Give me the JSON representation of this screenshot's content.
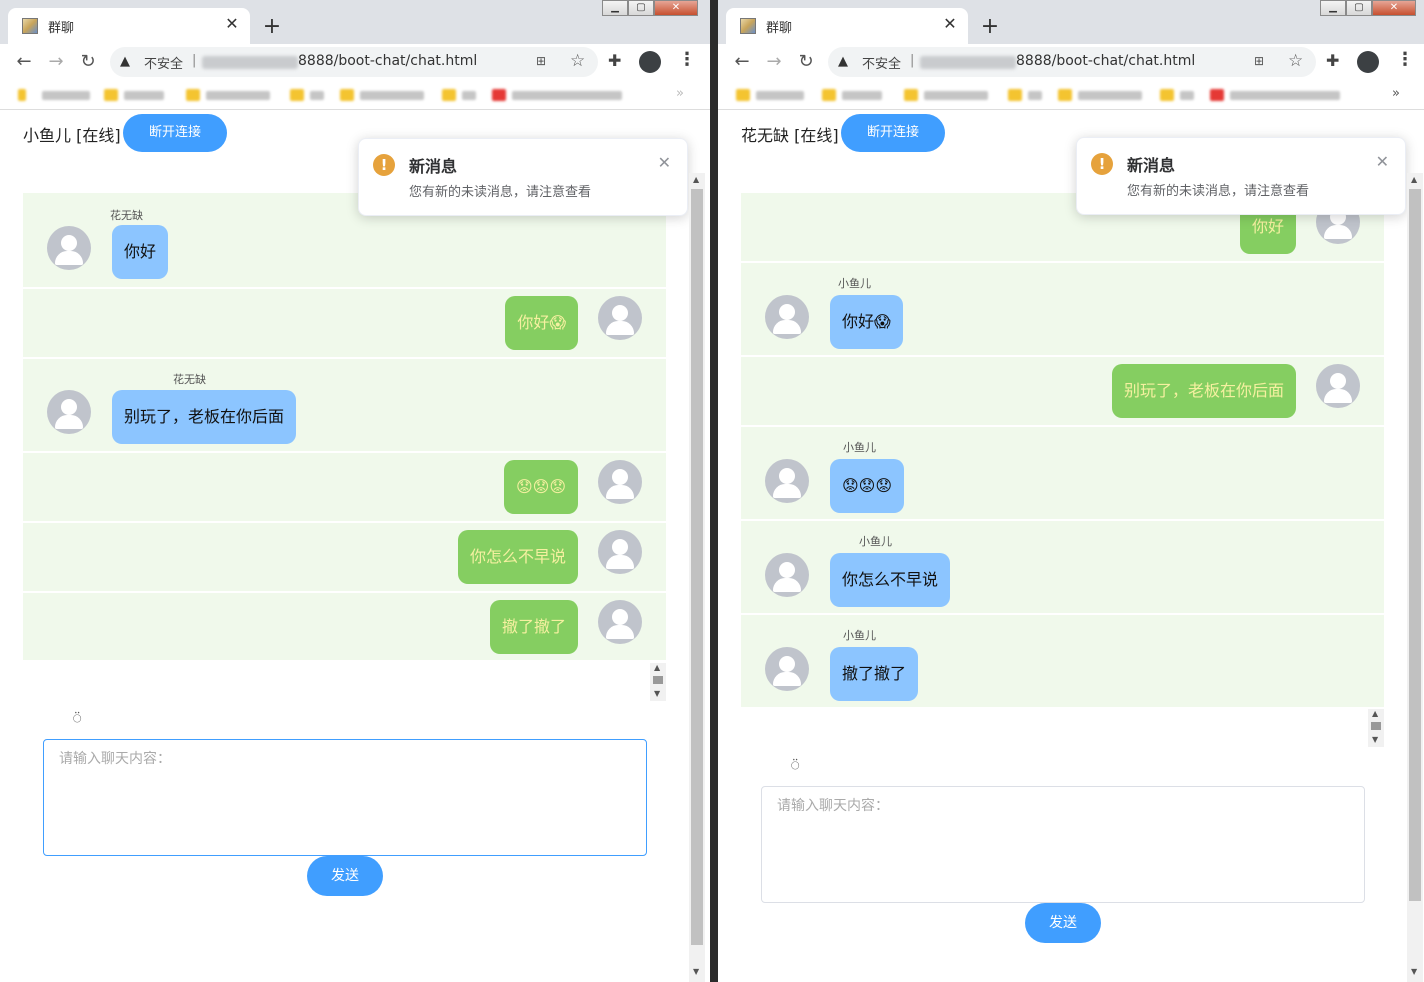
{
  "left": {
    "tab_title": "群聊",
    "security_text": "不安全",
    "url_path": "8888/boot-chat/chat.html",
    "user_label": "小鱼儿 [在线]",
    "disconnect_label": "断开连接",
    "messages": [
      {
        "dir": "in",
        "sender": "花无缺",
        "text": "你好"
      },
      {
        "dir": "out",
        "text": "你好😱"
      },
      {
        "dir": "in",
        "sender": "花无缺",
        "text": "别玩了，老板在你后面"
      },
      {
        "dir": "out",
        "text": "😟😟😟"
      },
      {
        "dir": "out",
        "text": "你怎么不早说"
      },
      {
        "dir": "out",
        "text": "撤了撤了"
      }
    ],
    "input_placeholder": "请输入聊天内容：",
    "send_label": "发送"
  },
  "right": {
    "tab_title": "群聊",
    "security_text": "不安全",
    "url_path": "8888/boot-chat/chat.html",
    "user_label": "花无缺 [在线]",
    "disconnect_label": "断开连接",
    "messages": [
      {
        "dir": "out",
        "text": "你好"
      },
      {
        "dir": "in",
        "sender": "小鱼儿",
        "text": "你好😱"
      },
      {
        "dir": "out",
        "text": "别玩了，老板在你后面"
      },
      {
        "dir": "in",
        "sender": "小鱼儿",
        "text": "😟😟😟"
      },
      {
        "dir": "in",
        "sender": "小鱼儿",
        "text": "你怎么不早说"
      },
      {
        "dir": "in",
        "sender": "小鱼儿",
        "text": "撤了撤了"
      }
    ],
    "input_placeholder": "请输入聊天内容：",
    "send_label": "发送"
  },
  "notification": {
    "title": "新消息",
    "message": "您有新的未读消息，请注意查看",
    "icon": "warning-icon"
  },
  "emoji_button_icon": "apple-icon",
  "colors": {
    "accent": "#409eff",
    "incoming_bubble": "#8cc5ff",
    "outgoing_bubble": "#85ce61",
    "chat_background": "#f0f9eb",
    "warning": "#e6a23c"
  }
}
